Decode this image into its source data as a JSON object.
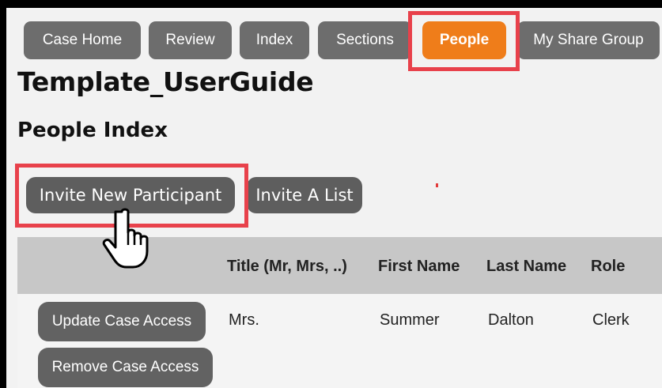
{
  "tabs": [
    {
      "label": "Case Home"
    },
    {
      "label": "Review"
    },
    {
      "label": "Index"
    },
    {
      "label": "Sections"
    },
    {
      "label": "People",
      "active": true
    },
    {
      "label": "My Share Group"
    }
  ],
  "page": {
    "title": "Template_UserGuide",
    "subtitle": "People Index"
  },
  "actions": {
    "invite_new": "Invite New Participant",
    "invite_list": "Invite A List"
  },
  "table": {
    "headers": [
      "Title (Mr, Mrs, ..)",
      "First Name",
      "Last Name",
      "Role"
    ],
    "rows": [
      {
        "update_access": "Update Case Access",
        "remove_access": "Remove Case Access",
        "cells": [
          "Mrs.",
          "Summer",
          "Dalton",
          "Clerk"
        ]
      }
    ]
  },
  "colors": {
    "tab_bg": "#6d6d6d",
    "tab_active_bg": "#ef7d1a",
    "highlight": "#e8414b",
    "header_bg": "#c7c7c7"
  },
  "icons": {
    "cursor": "hand-pointer-icon"
  }
}
